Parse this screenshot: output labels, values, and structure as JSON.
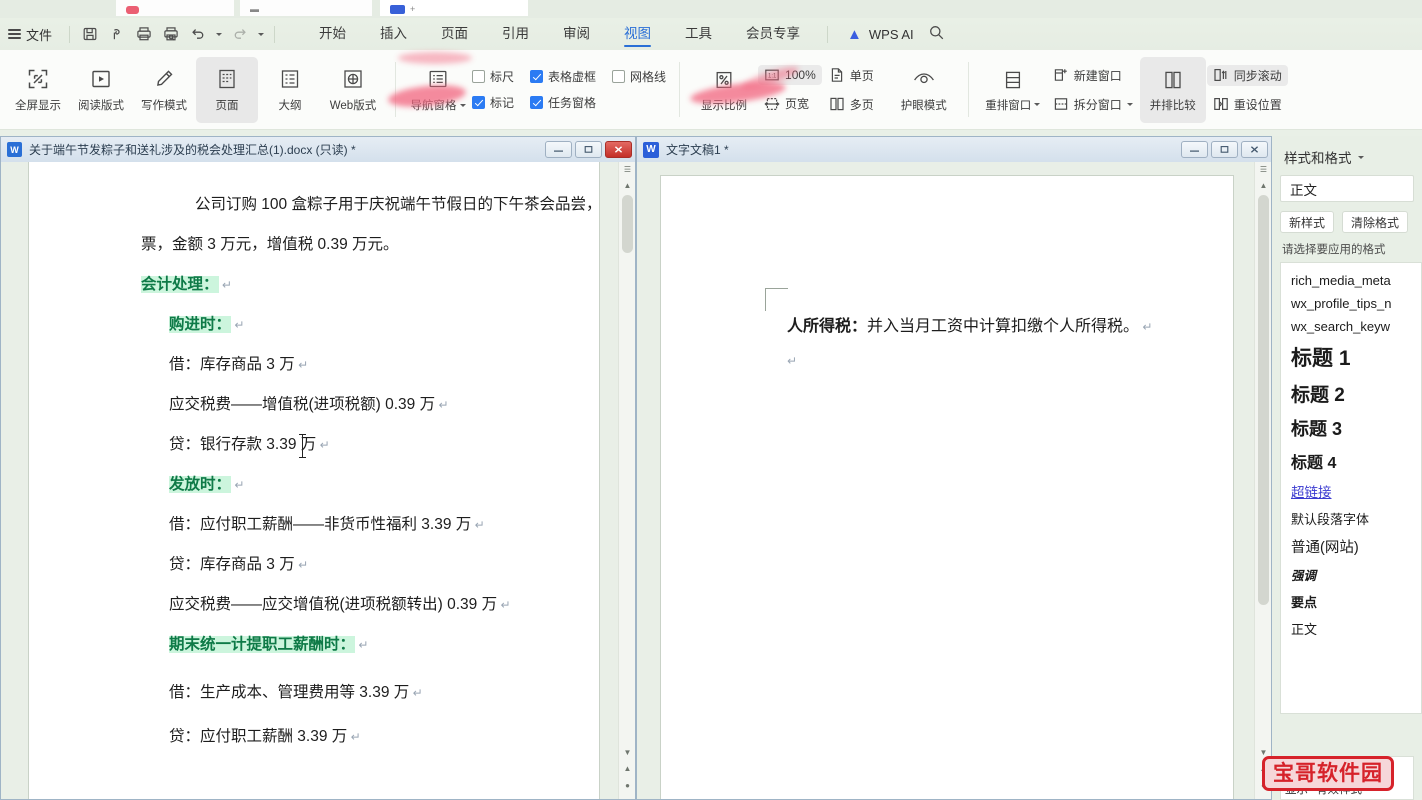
{
  "app": {
    "tabstrip": [
      {
        "label": "",
        "icon": "red-dot-icon"
      },
      {
        "label": "",
        "icon": "grey-dot-icon"
      },
      {
        "label": "",
        "icon": "blue-doc-icon"
      }
    ],
    "menubar": {
      "file_label": "文件",
      "quick_access": [
        {
          "name": "save-icon",
          "glyph": "save"
        },
        {
          "name": "cloud-sync-icon",
          "glyph": "cloud"
        },
        {
          "name": "print-icon",
          "glyph": "print"
        },
        {
          "name": "print-preview-icon",
          "glyph": "preview"
        },
        {
          "name": "undo-icon",
          "glyph": "undo"
        },
        {
          "name": "redo-icon",
          "glyph": "redo"
        },
        {
          "name": "more-icon",
          "glyph": "chevron"
        }
      ],
      "tabs": [
        {
          "label": "开始",
          "active": false
        },
        {
          "label": "插入",
          "active": false
        },
        {
          "label": "页面",
          "active": false
        },
        {
          "label": "引用",
          "active": false
        },
        {
          "label": "审阅",
          "active": false
        },
        {
          "label": "视图",
          "active": true
        },
        {
          "label": "工具",
          "active": false
        },
        {
          "label": "会员专享",
          "active": false
        }
      ],
      "ai_label": "WPS AI",
      "search_icon": "search-icon"
    },
    "ribbon": {
      "view_modes": [
        {
          "label": "全屏显示",
          "icon": "fullscreen-icon",
          "selected": false
        },
        {
          "label": "阅读版式",
          "icon": "read-layout-icon",
          "selected": false
        },
        {
          "label": "写作模式",
          "icon": "write-mode-icon",
          "selected": false
        },
        {
          "label": "页面",
          "icon": "page-layout-icon",
          "selected": true
        },
        {
          "label": "大纲",
          "icon": "outline-icon",
          "selected": false
        },
        {
          "label": "Web版式",
          "icon": "web-layout-icon",
          "selected": false
        }
      ],
      "nav_pane": {
        "label": "导航窗格",
        "icon": "navigation-pane-icon"
      },
      "checkboxes": [
        {
          "label": "标尺",
          "checked": false
        },
        {
          "label": "表格虚框",
          "checked": true
        },
        {
          "label": "网格线",
          "checked": false
        },
        {
          "label": "标记",
          "checked": true
        },
        {
          "label": "任务窗格",
          "checked": true
        }
      ],
      "zoom_group": {
        "display_ratio": {
          "label": "显示比例",
          "icon": "zoom-percent-icon"
        },
        "one_to_one": {
          "label": "100%",
          "icon": "one-to-one-icon"
        },
        "page_width": {
          "label": "页宽",
          "icon": "page-width-icon"
        },
        "single_page": {
          "label": "单页",
          "icon": "single-page-icon"
        },
        "multi_page": {
          "label": "多页",
          "icon": "multi-page-icon"
        },
        "eye_care": {
          "label": "护眼模式",
          "icon": "eye-icon"
        }
      },
      "window_group": {
        "rearrange": {
          "label": "重排窗口",
          "icon": "rearrange-window-icon"
        },
        "new_window": {
          "label": "新建窗口",
          "icon": "new-window-icon"
        },
        "split_window": {
          "label": "拆分窗口",
          "icon": "split-window-icon"
        },
        "side_by_side": {
          "label": "并排比较",
          "icon": "side-by-side-icon",
          "selected": true
        },
        "sync_scroll": {
          "label": "同步滚动",
          "icon": "sync-scroll-icon",
          "highlighted": true
        },
        "reset_position": {
          "label": "重设位置",
          "icon": "reset-position-icon"
        }
      }
    }
  },
  "left_window": {
    "title": "关于端午节发粽子和送礼涉及的税会处理汇总(1).docx (只读) *",
    "icon": "wps-doc-icon",
    "buttons": {
      "minimize": "—",
      "maximize": "❐",
      "close": "✕"
    },
    "document_lines": [
      {
        "text": "公司订购 100 盒粽子用于庆祝端午节假日的下午茶会品尝，",
        "style": "body",
        "indent": 44
      },
      {
        "text": "票，金额 3 万元，增值税 0.39 万元。",
        "style": "body",
        "indent": 0,
        "pilcrow": true
      },
      {
        "text": "会计处理：",
        "style": "heading",
        "indent": 0,
        "pilcrow": true
      },
      {
        "text": "购进时：",
        "style": "heading",
        "indent": 22,
        "pilcrow": true
      },
      {
        "text": "借：库存商品 3 万",
        "style": "body",
        "indent": 22,
        "pilcrow": true
      },
      {
        "text": "应交税费——增值税(进项税额)  0.39 万",
        "style": "body",
        "indent": 22,
        "pilcrow": true
      },
      {
        "text": "贷：银行存款 3.39 万",
        "style": "body",
        "indent": 22,
        "pilcrow": true
      },
      {
        "text": "发放时：",
        "style": "heading",
        "indent": 22,
        "pilcrow": true
      },
      {
        "text": "借：应付职工薪酬——非货币性福利 3.39 万",
        "style": "body",
        "indent": 22,
        "pilcrow": true
      },
      {
        "text": "贷：库存商品 3 万",
        "style": "body",
        "indent": 22,
        "pilcrow": true
      },
      {
        "text": "应交税费——应交增值税(进项税额转出)  0.39 万",
        "style": "body",
        "indent": 22,
        "pilcrow": true
      },
      {
        "text": "期末统一计提职工薪酬时：",
        "style": "heading",
        "indent": 22,
        "pilcrow": true
      },
      {
        "text": "借：生产成本、管理费用等 3.39 万",
        "style": "body",
        "indent": 22,
        "pilcrow": true
      },
      {
        "text": "贷：应付职工薪酬 3.39 万",
        "style": "body",
        "indent": 22,
        "pilcrow": true
      }
    ]
  },
  "right_window": {
    "title": "文字文稿1 *",
    "icon": "wps-writer-icon",
    "buttons": {
      "minimize": "—",
      "maximize": "❐",
      "close": "✕"
    },
    "document_lines": [
      {
        "bold_part": "人所得税：",
        "text": "并入当月工资中计算扣缴个人所得税。",
        "pilcrow": true
      },
      {
        "bold_part": "",
        "text": "",
        "pilcrow": true
      }
    ]
  },
  "styles_pane": {
    "title": "样式和格式",
    "dropdown_icon": "chevron-down-icon",
    "current_style": "正文",
    "new_style_button": "新样式",
    "clear_format_button": "清除格式",
    "section_label": "请选择要应用的格式",
    "style_items": [
      {
        "label": "rich_media_meta",
        "kind": "mono"
      },
      {
        "label": "wx_profile_tips_n",
        "kind": "mono"
      },
      {
        "label": "wx_search_keyw",
        "kind": "mono"
      },
      {
        "label": "标题 1",
        "kind": "h1"
      },
      {
        "label": "标题 2",
        "kind": "h2"
      },
      {
        "label": "标题 3",
        "kind": "h3"
      },
      {
        "label": "标题 4",
        "kind": "h4"
      },
      {
        "label": "超链接",
        "kind": "link"
      },
      {
        "label": "默认段落字体",
        "kind": "plain"
      },
      {
        "label": "普通(网站)",
        "kind": "normal"
      },
      {
        "label": "强调",
        "kind": "em"
      },
      {
        "label": "要点",
        "kind": "key"
      },
      {
        "label": "正文",
        "kind": "plain"
      }
    ],
    "footer": {
      "show_label": "显示",
      "valid_styles_label": "有效样式"
    }
  },
  "watermark": {
    "text": "宝哥软件园",
    "color": "#d6222a"
  },
  "colors": {
    "accent": "#2a6fd6",
    "ribbon_bg": "#fbfcfa",
    "menu_bg": "#e9f0e6",
    "checkbox_on": "#2b7bf3",
    "heading_green": "#0e7a47",
    "heading_green_bg": "#ccf5dd",
    "titlebar": "#d4e0ec"
  }
}
